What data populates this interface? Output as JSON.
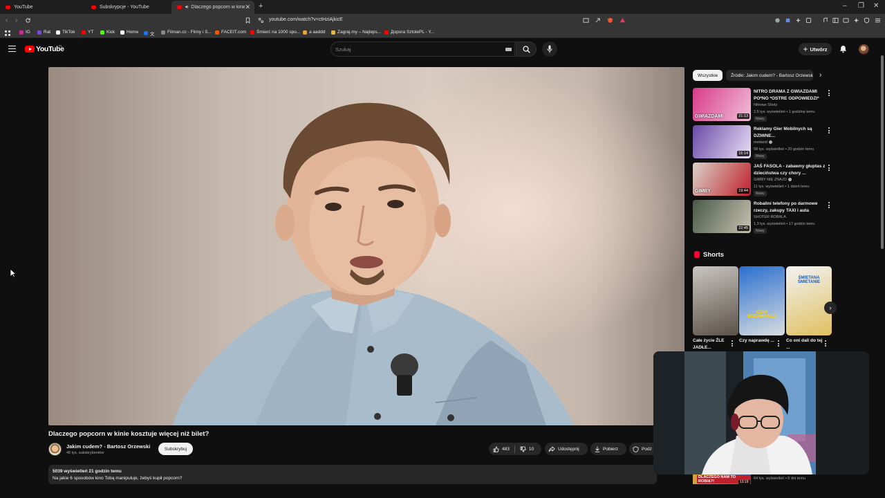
{
  "browser": {
    "tabs": [
      {
        "label": "YouTube",
        "active": false
      },
      {
        "label": "Subskrypcje - YouTube",
        "active": false
      },
      {
        "label": "Dlaczego popcorn w kinie k",
        "active": true
      }
    ],
    "new_tab": "+",
    "url": "youtube.com/watch?v=ctHziAjkicE",
    "bookmarks": [
      {
        "label": "IG",
        "color": "#d6249f"
      },
      {
        "label": "Rat",
        "color": "#7b4dd6"
      },
      {
        "label": "TikTok",
        "color": "#ffffff"
      },
      {
        "label": "YT",
        "color": "#ff0000"
      },
      {
        "label": "Kick",
        "color": "#53fc18"
      },
      {
        "label": "Home",
        "color": "#ffffff"
      },
      {
        "label": "文",
        "color": "#1a73e8"
      },
      {
        "label": "Filman.cc - Filmy i S...",
        "color": "#888888"
      },
      {
        "label": "FACEIT.com",
        "color": "#ff5500"
      },
      {
        "label": "Śmierć na 1000 spo...",
        "color": "#ff0000"
      },
      {
        "label": "a aaddd",
        "color": "#e8a33d"
      },
      {
        "label": "Zagraj.my – Najleps...",
        "color": "#e8b93d"
      },
      {
        "label": "Дорога SztolePL - Y...",
        "color": "#ff0000"
      }
    ]
  },
  "header": {
    "logo_text": "YouTube",
    "region": "PL",
    "search_placeholder": "Szukaj",
    "create_label": "Utwórz"
  },
  "video": {
    "title": "Dlaczego popcorn w kinie kosztuje więcej niż bilet?",
    "channel": "Jakim cudem? - Bartosz Orzewski",
    "subscribers": "46 tys. subskrybentów",
    "subscribe_label": "Subskrybuj",
    "likes": "483",
    "dislikes": "10",
    "share_label": "Udostępnij",
    "download_label": "Pobierz",
    "save_label": "Podz",
    "views_line": "5039 wyświetleń  21 godzin temu",
    "description": "Na jakie 6 sposobów kino Tobą manipuluje, żebyś kupił popcorn?"
  },
  "sidebar": {
    "chips": [
      {
        "label": "Wszystkie",
        "selected": true
      },
      {
        "label": "Źródło: Jakim cudem? - Bartosz Orzewski",
        "selected": false
      }
    ],
    "recommendations": [
      {
        "title": "NITRO DRAMA Z GWIAZDAMI PO*NO *OSTRE ODPOWIEDZI*",
        "channel": "Nitrowe Shoty",
        "verified": false,
        "meta": "2,5 tys. wyświetleń • 1 godzinę temu",
        "badge": "Nowy",
        "duration": "21:13",
        "thumb_text": "GWIAZDAMI",
        "colors": [
          "#d83a8a",
          "#f0c0d8"
        ]
      },
      {
        "title": "Reklamy Gier Mobilnych są DZIWNE...",
        "channel": "medarid",
        "verified": true,
        "meta": "58 tys. wyświetleń • 20 godzin temu",
        "badge": "Nowy",
        "duration": "15:14",
        "thumb_text": "",
        "colors": [
          "#6a4aa8",
          "#e9e0f5"
        ]
      },
      {
        "title": "JAŚ FASOLA - zabawny głuptas z dzieciństwa czy chory ...",
        "channel": "GIMBY NIE ZNAJO",
        "verified": true,
        "meta": "11 tys. wyświetleń • 1 dzień temu",
        "badge": "Nowy",
        "duration": "19:44",
        "thumb_text": "GIMBY",
        "colors": [
          "#d9d2c8",
          "#c0202a"
        ]
      },
      {
        "title": "Robaliní telefony po darmowe rzeczy, zakupy TAXI i auta",
        "channel": "SHOTER ROBALA",
        "verified": false,
        "meta": "1,3 tys. wyświetleń • 17 godzin temu",
        "badge": "Nowy",
        "duration": "22:45",
        "thumb_text": "",
        "colors": [
          "#4a5a48",
          "#c8c2b0"
        ]
      }
    ],
    "shorts_title": "Shorts",
    "shorts": [
      {
        "title": "Całe życie ŹLE JADŁE...",
        "colors": [
          "#c9c6c0",
          "#5a5048"
        ]
      },
      {
        "title": "Czy naprawdę ...",
        "colors": [
          "#2a6fd0",
          "#d9dde0"
        ],
        "caption": "CZAS EGZAMINACJI"
      },
      {
        "title": "Co oni dali do tej ...",
        "colors": [
          "#f2f2f2",
          "#e0c060"
        ],
        "caption": "ŚMIETANA ŚMIETANIE"
      }
    ],
    "bottom_rec": {
      "thumb_text": "DLACZEGO NAM TO ROBIĄ?!",
      "meta": "64 tys. wyświetleń • 6 dni temu",
      "duration": "13:19"
    }
  },
  "colors": {
    "accent_red": "#ff0000",
    "bg": "#0f0f0f",
    "chip_bg": "#272727"
  }
}
